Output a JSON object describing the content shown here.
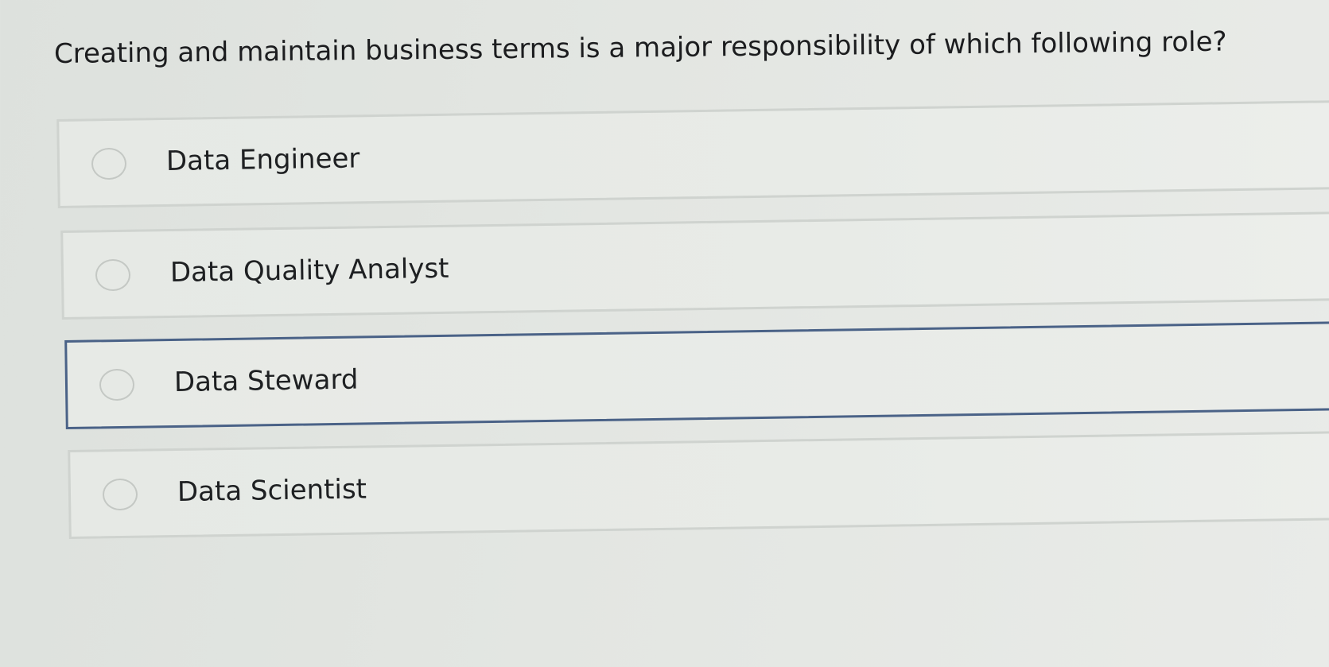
{
  "question": {
    "text": "Creating and maintain business terms is a major responsibility of which following role?"
  },
  "options": [
    {
      "label": "Data Engineer",
      "selected": false,
      "focused": false
    },
    {
      "label": "Data Quality Analyst",
      "selected": false,
      "focused": false
    },
    {
      "label": "Data Steward",
      "selected": false,
      "focused": true
    },
    {
      "label": "Data Scientist",
      "selected": false,
      "focused": false
    }
  ],
  "colors": {
    "focus_border": "#4a6287",
    "option_border": "#cfd3cf",
    "background": "#e3e6e2"
  }
}
